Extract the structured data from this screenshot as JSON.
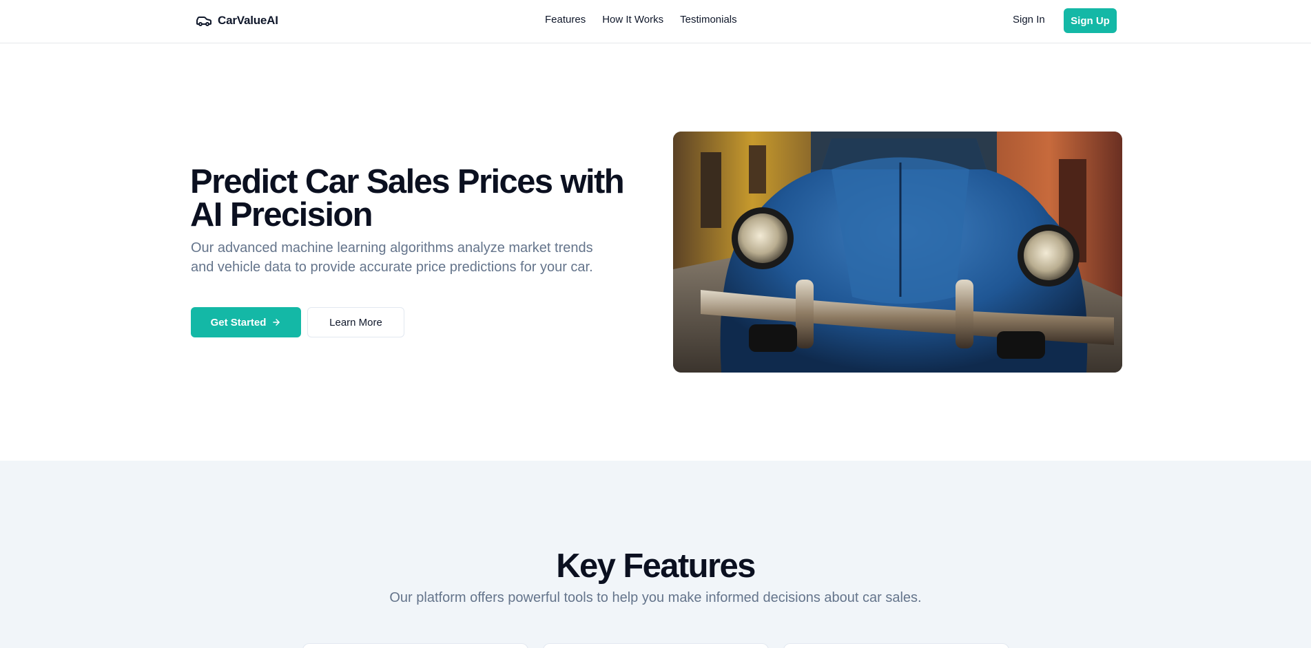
{
  "header": {
    "brand": "CarValueAI",
    "brand_icon": "car-icon",
    "nav": [
      "Features",
      "How It Works",
      "Testimonials"
    ],
    "signin": "Sign In",
    "signup": "Sign Up"
  },
  "hero": {
    "title": "Predict Car Sales Prices with AI Precision",
    "subtitle": "Our advanced machine learning algorithms analyze market trends and vehicle data to provide accurate price predictions for your car.",
    "primary_cta": "Get Started",
    "primary_cta_icon": "arrow-right-icon",
    "secondary_cta": "Learn More",
    "image": "vintage-blue-car-photo"
  },
  "features": {
    "title": "Key Features",
    "subtitle": "Our platform offers powerful tools to help you make informed decisions about car sales."
  },
  "colors": {
    "accent": "#14b8a6",
    "muted_text": "#64748b",
    "section_bg": "#f1f5f9"
  }
}
